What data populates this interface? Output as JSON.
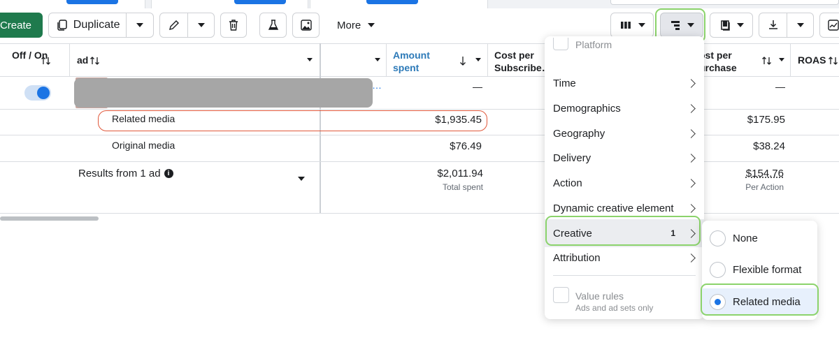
{
  "toolbar": {
    "create_label": "Create",
    "duplicate_label": "Duplicate",
    "more_label": "More"
  },
  "table": {
    "headers": {
      "toggle": "Off / On",
      "ad": "ad",
      "amount_spent": "Amount spent",
      "cost_per_subscribe": "Cost per Subscribe…",
      "cost_per_purchase": "ost per urchase",
      "roas": "ROAS"
    },
    "ad_row": {
      "amount_spent": "…",
      "dash1": "—",
      "dash2": "—"
    },
    "rows": [
      {
        "label": "Related media",
        "amount_spent": "$1,935.45",
        "cost_per_purchase": "$175.95"
      },
      {
        "label": "Original media",
        "amount_spent": "$76.49",
        "cost_per_purchase": "$38.24"
      }
    ],
    "results": {
      "label": "Results from 1 ad",
      "amount_spent": "$2,011.94",
      "amount_spent_sub": "Total spent",
      "cost_per_purchase": "$154.76",
      "cost_per_purchase_sub": "Per Action"
    }
  },
  "breakdown_menu": {
    "top_partial": "Platform",
    "items": [
      "Time",
      "Demographics",
      "Geography",
      "Delivery",
      "Action",
      "Dynamic creative element",
      "Creative",
      "Attribution"
    ],
    "creative_count": "1",
    "value_rules_label": "Value rules",
    "value_rules_sub": "Ads and ad sets only"
  },
  "creative_submenu": {
    "options": [
      "None",
      "Flexible format",
      "Related media"
    ],
    "selected": "Related media"
  },
  "colors": {
    "accent": "#1b74e4",
    "create": "#1f7a4d",
    "highlight_green": "#8bd36b",
    "highlight_red": "#e0573a"
  }
}
